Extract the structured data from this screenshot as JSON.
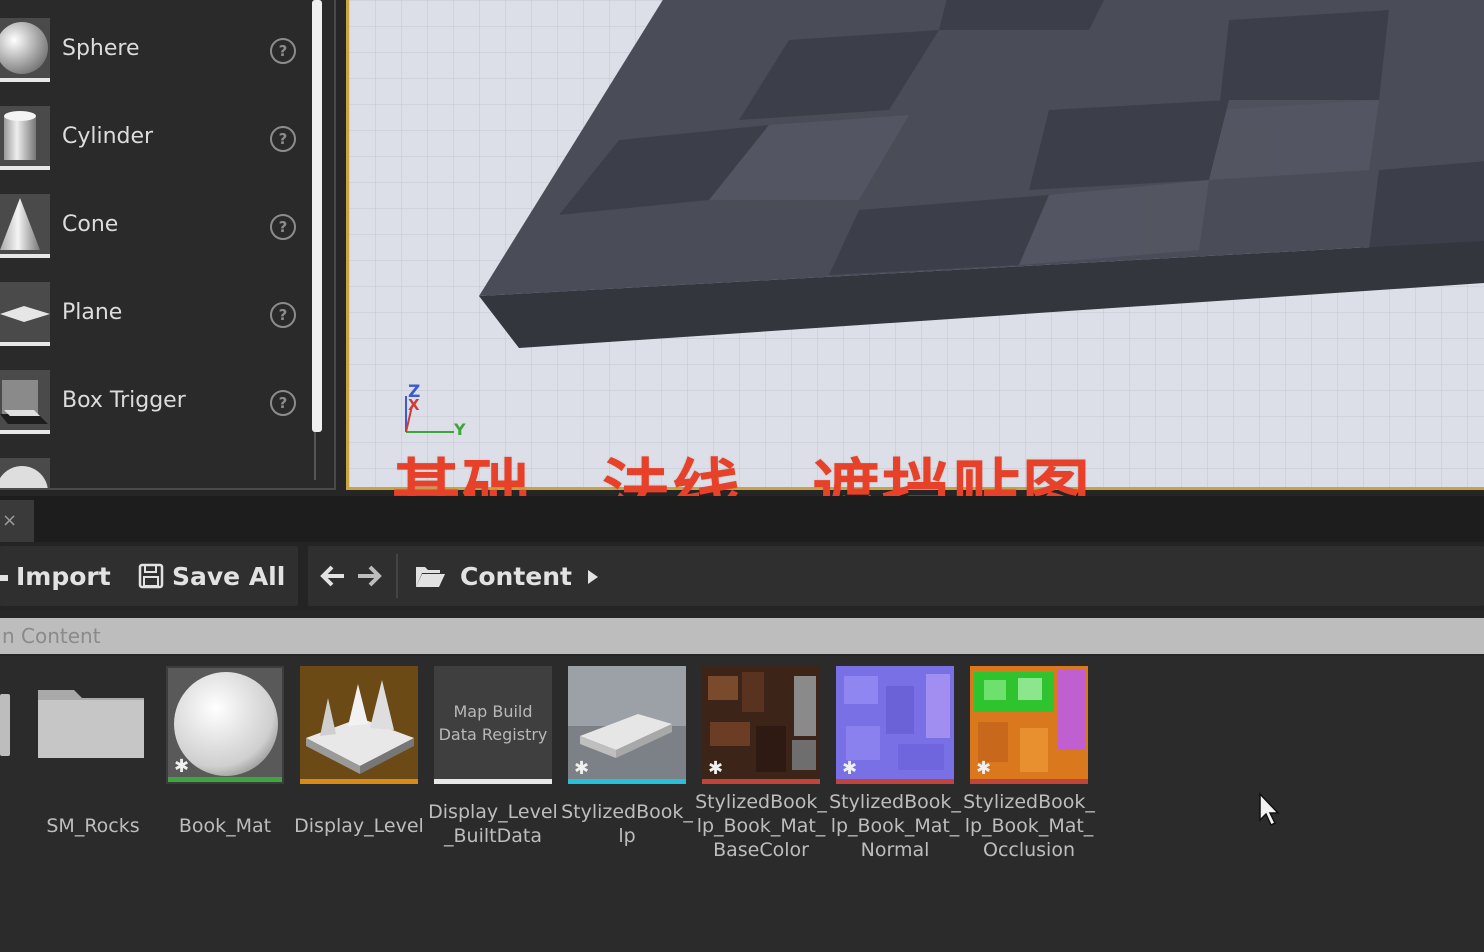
{
  "place_actors": {
    "items": [
      {
        "label": "Sphere",
        "icon": "sphere-icon"
      },
      {
        "label": "Cylinder",
        "icon": "cylinder-icon"
      },
      {
        "label": "Cone",
        "icon": "cone-icon"
      },
      {
        "label": "Plane",
        "icon": "plane-icon"
      },
      {
        "label": "Box Trigger",
        "icon": "box-trigger-icon"
      }
    ],
    "help_glyph": "?"
  },
  "viewport": {
    "axis": {
      "z": "Z",
      "x": "X",
      "y": "Y"
    },
    "overlay_caption": "基础，法线，遮挡贴图"
  },
  "content_browser": {
    "tab_close": "×",
    "toolbar": {
      "import_label": "Import",
      "save_all_label": "Save All",
      "path_label": "Content"
    },
    "filter": {
      "placeholder": "n Content"
    },
    "assets": [
      {
        "name": "SM_Rocks",
        "type": "folder",
        "bar_color": "#2b2b2b"
      },
      {
        "name": "Book_Mat",
        "type": "material",
        "bar_color": "#3ea63e"
      },
      {
        "name": "Display_Level",
        "type": "level",
        "bar_color": "#d68a1a"
      },
      {
        "name": "Display_Level\n_BuiltData",
        "type": "map-build-data",
        "thumb_text": "Map Build\nData Registry",
        "bar_color": "#e8e8e8"
      },
      {
        "name": "StylizedBook_\nlp",
        "type": "static-mesh",
        "bar_color": "#27c0d8"
      },
      {
        "name": "StylizedBook_\nlp_Book_Mat_\nBaseColor",
        "type": "texture",
        "bar_color": "#c0443a"
      },
      {
        "name": "StylizedBook_\nlp_Book_Mat_\nNormal",
        "type": "texture",
        "bar_color": "#c0443a"
      },
      {
        "name": "StylizedBook_\nlp_Book_Mat_\nOcclusion",
        "type": "texture",
        "bar_color": "#c0443a"
      }
    ]
  }
}
